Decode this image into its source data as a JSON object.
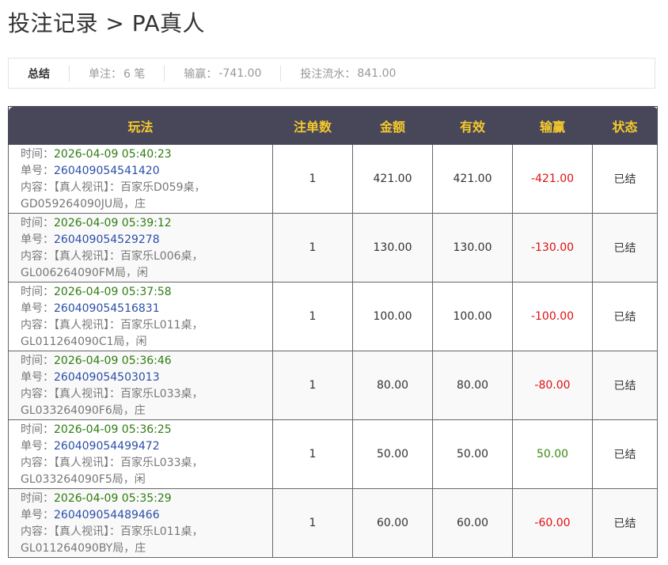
{
  "page": {
    "title": "投注记录 > PA真人"
  },
  "summary": {
    "label": "总结",
    "count_label": "单注：",
    "count_value": "6 笔",
    "winloss_label": "输赢：",
    "winloss_value": "-741.00",
    "turnover_label": "投注流水：",
    "turnover_value": "841.00"
  },
  "table": {
    "headers": [
      "玩法",
      "注单数",
      "金额",
      "有效",
      "输赢",
      "状态"
    ],
    "rows": [
      {
        "time_label": "时间：",
        "time": "2026-04-09 05:40:23",
        "order_label": "单号：",
        "order": "260409054541420",
        "content_label": "内容：",
        "content_1": "【真人视讯】：百家乐D059桌，",
        "content_2": "GD059264090JU局，庄",
        "count": "1",
        "amount": "421.00",
        "valid": "421.00",
        "winloss": "-421.00",
        "status": "已结"
      },
      {
        "time_label": "时间：",
        "time": "2026-04-09 05:39:12",
        "order_label": "单号：",
        "order": "260409054529278",
        "content_label": "内容：",
        "content_1": "【真人视讯】：百家乐L006桌，",
        "content_2": "GL006264090FM局，闲",
        "count": "1",
        "amount": "130.00",
        "valid": "130.00",
        "winloss": "-130.00",
        "status": "已结"
      },
      {
        "time_label": "时间：",
        "time": "2026-04-09 05:37:58",
        "order_label": "单号：",
        "order": "260409054516831",
        "content_label": "内容：",
        "content_1": "【真人视讯】：百家乐L011桌，",
        "content_2": "GL011264090C1局，闲",
        "count": "1",
        "amount": "100.00",
        "valid": "100.00",
        "winloss": "-100.00",
        "status": "已结"
      },
      {
        "time_label": "时间：",
        "time": "2026-04-09 05:36:46",
        "order_label": "单号：",
        "order": "260409054503013",
        "content_label": "内容：",
        "content_1": "【真人视讯】：百家乐L033桌，",
        "content_2": "GL033264090F6局，庄",
        "count": "1",
        "amount": "80.00",
        "valid": "80.00",
        "winloss": "-80.00",
        "status": "已结"
      },
      {
        "time_label": "时间：",
        "time": "2026-04-09 05:36:25",
        "order_label": "单号：",
        "order": "260409054499472",
        "content_label": "内容：",
        "content_1": "【真人视讯】：百家乐L033桌，",
        "content_2": "GL033264090F5局，闲",
        "count": "1",
        "amount": "50.00",
        "valid": "50.00",
        "winloss": "50.00",
        "status": "已结"
      },
      {
        "time_label": "时间：",
        "time": "2026-04-09 05:35:29",
        "order_label": "单号：",
        "order": "260409054489466",
        "content_label": "内容：",
        "content_1": "【真人视讯】：百家乐L011桌，",
        "content_2": "GL011264090BY局，庄",
        "count": "1",
        "amount": "60.00",
        "valid": "60.00",
        "winloss": "-60.00",
        "status": "已结"
      }
    ]
  },
  "colors": {
    "header_bg": "#474759",
    "header_text": "#f6c92c",
    "time_text": "#2e7d0f",
    "order_text": "#2b4ea8",
    "loss_text": "#e01010",
    "win_text": "#3a8a12"
  }
}
